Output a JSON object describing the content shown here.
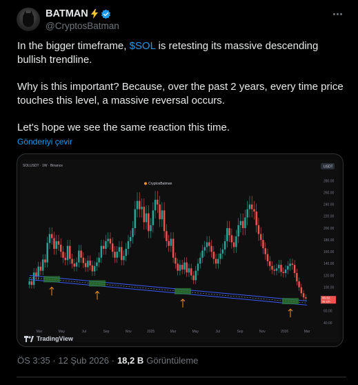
{
  "author": {
    "display_name": "BATMAN",
    "handle": "@CryptosBatman"
  },
  "tweet": {
    "para1_pre": "In the bigger timeframe, ",
    "cashtag": "$SOL",
    "para1_post": " is retesting its massive descending bullish trendline.",
    "para2": "Why is this important? Because, over the past 2 years, every time price touches this level, a massive reversal occurs.",
    "para3": "Let's hope we see the same reaction this time.",
    "translate": "Gönderiyi çevir"
  },
  "chart_data": {
    "type": "candlestick",
    "symbol_label": "SOLUSDT · 1W · Binance",
    "watermark": "CryptosBatman",
    "currency": "USDT",
    "price_label": "80.62",
    "price_sub": "3d 12h",
    "y_ticks": [
      "280.00",
      "260.00",
      "240.00",
      "220.00",
      "200.00",
      "180.00",
      "160.00",
      "140.00",
      "120.00",
      "100.00",
      "80.00",
      "60.00",
      "40.00"
    ],
    "x_ticks": [
      "Mar",
      "May",
      "Jul",
      "Sep",
      "Nov",
      "2025",
      "Mar",
      "May",
      "Jul",
      "Sep",
      "Nov",
      "2026",
      "Mar"
    ],
    "ylim": [
      40,
      290
    ],
    "close_series": [
      110,
      104,
      125,
      118,
      135,
      128,
      147,
      142,
      175,
      190,
      183,
      165,
      178,
      172,
      160,
      150,
      146,
      170,
      148,
      140,
      135,
      142,
      162,
      150,
      141,
      134,
      145,
      137,
      127,
      136,
      142,
      150,
      170,
      165,
      178,
      182,
      174,
      160,
      150,
      160,
      168,
      146,
      153,
      165,
      178,
      185,
      200,
      232,
      246,
      232,
      236,
      210,
      225,
      195,
      205,
      230,
      248,
      240,
      215,
      230,
      195,
      178,
      170,
      182,
      150,
      140,
      128,
      138,
      130,
      142,
      125,
      132,
      120,
      112,
      128,
      140,
      150,
      162,
      168,
      176,
      170,
      160,
      148,
      140,
      148,
      157,
      164,
      178,
      200,
      188,
      176,
      168,
      186,
      205,
      212,
      200,
      218,
      232,
      240,
      232,
      228,
      205,
      190,
      180,
      166,
      156,
      144,
      136,
      130,
      128,
      132,
      138,
      126,
      124,
      130,
      136,
      140,
      138,
      124,
      110,
      100,
      90,
      83,
      81
    ],
    "touch_markers": 4,
    "trendline": "descending channel"
  },
  "footer": {
    "time": "ÖS 3:35 · 12 Şub 2026 · ",
    "views_num": "18,2 B",
    "views_label": "Görüntüleme"
  },
  "brand": {
    "tradingview": "TradingView"
  },
  "colors": {
    "accent": "#1d9bf0",
    "up": "#26a69a",
    "down": "#ef5350",
    "marker": "#f7931a",
    "trend": "#3b5cff"
  }
}
